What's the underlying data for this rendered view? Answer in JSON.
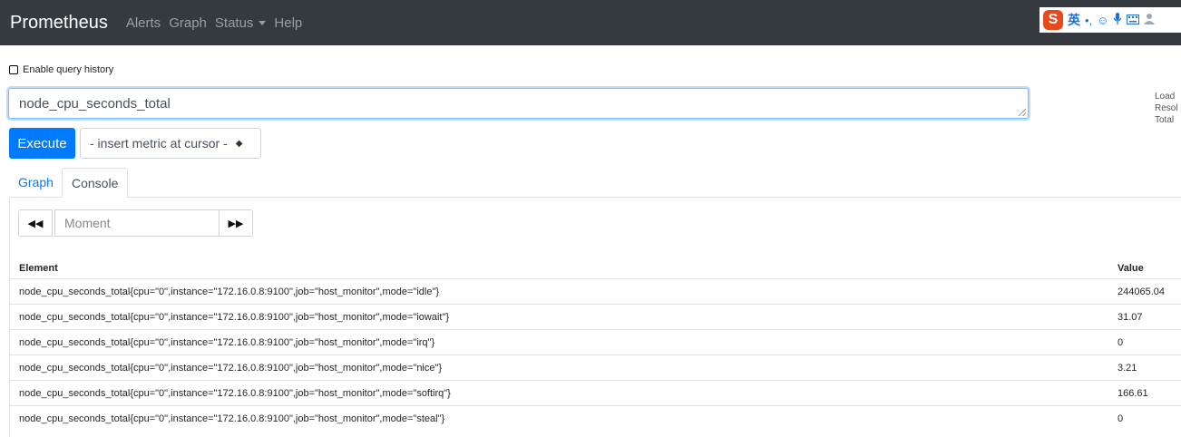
{
  "nav": {
    "brand": "Prometheus",
    "links": [
      "Alerts",
      "Graph",
      "Status",
      "Help"
    ]
  },
  "ime": {
    "logo": "S",
    "lang": "英",
    "icons": [
      "punctuation-icon",
      "emoji-icon",
      "mic-icon",
      "keyboard-icon",
      "user-icon"
    ]
  },
  "history": {
    "label": "Enable query history",
    "checked": false
  },
  "query": {
    "value": "node_cpu_seconds_total"
  },
  "side_info": [
    "Load",
    "Resol",
    "Total"
  ],
  "controls": {
    "execute_label": "Execute",
    "metric_select": "- insert metric at cursor -"
  },
  "tabs": [
    {
      "label": "Graph",
      "active": false
    },
    {
      "label": "Console",
      "active": true
    }
  ],
  "console": {
    "moment_placeholder": "Moment",
    "columns": [
      "Element",
      "Value"
    ],
    "rows": [
      {
        "element": "node_cpu_seconds_total{cpu=\"0\",instance=\"172.16.0.8:9100\",job=\"host_monitor\",mode=\"idle\"}",
        "value": "244065.04"
      },
      {
        "element": "node_cpu_seconds_total{cpu=\"0\",instance=\"172.16.0.8:9100\",job=\"host_monitor\",mode=\"iowait\"}",
        "value": "31.07"
      },
      {
        "element": "node_cpu_seconds_total{cpu=\"0\",instance=\"172.16.0.8:9100\",job=\"host_monitor\",mode=\"irq\"}",
        "value": "0"
      },
      {
        "element": "node_cpu_seconds_total{cpu=\"0\",instance=\"172.16.0.8:9100\",job=\"host_monitor\",mode=\"nice\"}",
        "value": "3.21"
      },
      {
        "element": "node_cpu_seconds_total{cpu=\"0\",instance=\"172.16.0.8:9100\",job=\"host_monitor\",mode=\"softirq\"}",
        "value": "166.61"
      },
      {
        "element": "node_cpu_seconds_total{cpu=\"0\",instance=\"172.16.0.8:9100\",job=\"host_monitor\",mode=\"steal\"}",
        "value": "0"
      }
    ]
  }
}
